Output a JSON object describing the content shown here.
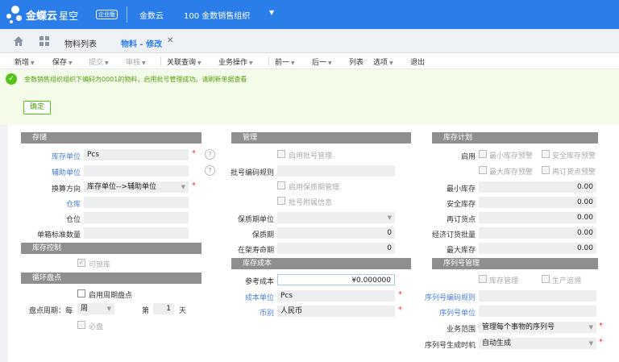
{
  "app": {
    "brand": "金蝶云",
    "product": "星空",
    "edition": "企业版",
    "cloud": "金数云",
    "org": "100  金数销售组织"
  },
  "tabs": {
    "list": "物料列表",
    "edit": "物料 - 修改"
  },
  "toolbar": {
    "items": [
      "新增",
      "保存",
      "提交",
      "审核",
      "关联查询",
      "业务操作",
      "前一",
      "后一",
      "列表",
      "选项",
      "退出"
    ],
    "disabled": [
      "提交",
      "审核"
    ]
  },
  "notice": {
    "text": "金数销售组织组织下编码为0001的物料，启用批号管理成功。请刷新单据查看",
    "confirm": "确定"
  },
  "storage": {
    "title": "存储",
    "stock_unit_label": "库存单位",
    "stock_unit": "Pcs",
    "aux_unit_label": "辅助单位",
    "conv_label": "换算方向",
    "conv": "库存单位-->辅助单位",
    "warehouse_label": "仓库",
    "location_label": "仓位",
    "box_qty_label": "单箱标准数量"
  },
  "stock_control": {
    "title": "库存控制",
    "lockable": "可锁库"
  },
  "cycle": {
    "title": "循环盘点",
    "enable": "启用周期盘点",
    "period_label": "盘点周期：每",
    "period_unit": "周",
    "nth_label": "第",
    "nth": "1",
    "day_label": "天",
    "must": "必盘"
  },
  "management": {
    "title": "管理",
    "batch_enable": "启用批号管理",
    "batch_rule_label": "批号编码规则",
    "shelf_enable": "启用保质期管理",
    "batch_attach": "批号附属信息",
    "shelf_unit_label": "保质期单位",
    "shelf_label": "保质期",
    "shelf": "0",
    "shelf_remain_label": "在架寿命期",
    "shelf_remain": "0"
  },
  "stock_cost": {
    "title": "库存成本",
    "ref_cost_label": "参考成本",
    "ref_cost": "¥0.000000",
    "cost_unit_label": "成本单位",
    "cost_unit": "Pcs",
    "currency_label": "币别",
    "currency": "人民币"
  },
  "plan": {
    "title": "库存计划",
    "enable_label": "启用",
    "min_warn": "最小库存预警",
    "safe_warn": "安全库存预警",
    "max_warn": "最大库存预警",
    "reorder_warn": "再订货点预警",
    "min_label": "最小库存",
    "min": "0.00",
    "safe_label": "安全库存",
    "safe": "0.00",
    "reorder_label": "再订货点",
    "reorder": "0.00",
    "eoq_label": "经济订货批量",
    "eoq": "0.00",
    "max_label": "最大库存",
    "max": "0.00"
  },
  "serial": {
    "title": "序列号管理",
    "stock_mgmt": "库存管理",
    "trace": "生产追溯",
    "rule_label": "序列号编码规则",
    "unit_label": "序列号单位",
    "scope_label": "业务范围",
    "scope": "管理每个事物的序列号",
    "gen_label": "序列号生成时机",
    "gen": "自动生成"
  },
  "colors": {
    "header": "#2b7de9",
    "success": "#52c41a",
    "section": "#8f8f8f",
    "required": "#e33333"
  }
}
